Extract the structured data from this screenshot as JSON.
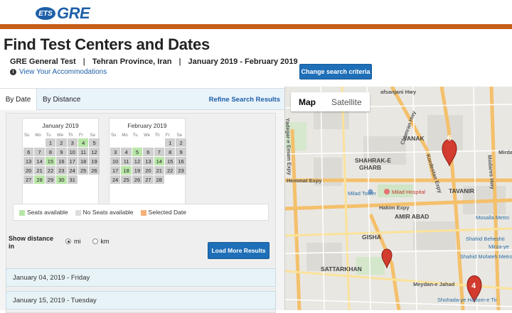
{
  "header": {
    "logo_ets": "ETS",
    "logo_gre": "GRE",
    "brand_color": "#1d5fa8",
    "accent_color": "#c65f1a"
  },
  "page": {
    "title": "Find Test Centers and Dates",
    "test": "GRE General Test",
    "location": "Tehran Province, Iran",
    "date_range": "January 2019 - February 2019",
    "accommodations_link": "View Your Accommodations",
    "change_button": "Change search criteria"
  },
  "tabs": {
    "by_date": "By Date",
    "by_distance": "By Distance",
    "refine": "Refine Search Results"
  },
  "calendars": [
    {
      "title": "January 2019",
      "dow": [
        "Su",
        "Mo",
        "Tu",
        "We",
        "Th",
        "Fr",
        "Sa"
      ],
      "lead_blanks": 2,
      "days": [
        {
          "d": "1",
          "s": "noseat"
        },
        {
          "d": "2",
          "s": "noseat"
        },
        {
          "d": "3",
          "s": "noseat"
        },
        {
          "d": "4",
          "s": "avail"
        },
        {
          "d": "5",
          "s": "noseat"
        },
        {
          "d": "6",
          "s": "noseat"
        },
        {
          "d": "7",
          "s": "noseat"
        },
        {
          "d": "8",
          "s": "noseat"
        },
        {
          "d": "9",
          "s": "noseat"
        },
        {
          "d": "10",
          "s": "noseat"
        },
        {
          "d": "11",
          "s": "noseat"
        },
        {
          "d": "12",
          "s": "noseat"
        },
        {
          "d": "13",
          "s": "noseat"
        },
        {
          "d": "14",
          "s": "noseat"
        },
        {
          "d": "15",
          "s": "avail"
        },
        {
          "d": "16",
          "s": "noseat"
        },
        {
          "d": "17",
          "s": "noseat"
        },
        {
          "d": "18",
          "s": "noseat"
        },
        {
          "d": "19",
          "s": "noseat"
        },
        {
          "d": "20",
          "s": "noseat"
        },
        {
          "d": "21",
          "s": "noseat"
        },
        {
          "d": "22",
          "s": "noseat"
        },
        {
          "d": "23",
          "s": "noseat"
        },
        {
          "d": "24",
          "s": "noseat"
        },
        {
          "d": "25",
          "s": "noseat"
        },
        {
          "d": "26",
          "s": "noseat"
        },
        {
          "d": "27",
          "s": "noseat"
        },
        {
          "d": "28",
          "s": "avail"
        },
        {
          "d": "29",
          "s": "noseat"
        },
        {
          "d": "30",
          "s": "avail"
        },
        {
          "d": "31",
          "s": "noseat"
        }
      ]
    },
    {
      "title": "February 2019",
      "dow": [
        "Su",
        "Mo",
        "Tu",
        "We",
        "Th",
        "Fr",
        "Sa"
      ],
      "lead_blanks": 5,
      "days": [
        {
          "d": "1",
          "s": "noseat"
        },
        {
          "d": "2",
          "s": "noseat"
        },
        {
          "d": "3",
          "s": "noseat"
        },
        {
          "d": "4",
          "s": "noseat"
        },
        {
          "d": "5",
          "s": "avail"
        },
        {
          "d": "6",
          "s": "noseat"
        },
        {
          "d": "7",
          "s": "noseat"
        },
        {
          "d": "8",
          "s": "noseat"
        },
        {
          "d": "9",
          "s": "noseat"
        },
        {
          "d": "10",
          "s": "noseat"
        },
        {
          "d": "11",
          "s": "noseat"
        },
        {
          "d": "12",
          "s": "noseat"
        },
        {
          "d": "13",
          "s": "noseat"
        },
        {
          "d": "14",
          "s": "avail"
        },
        {
          "d": "15",
          "s": "noseat"
        },
        {
          "d": "16",
          "s": "noseat"
        },
        {
          "d": "17",
          "s": "noseat"
        },
        {
          "d": "18",
          "s": "avail"
        },
        {
          "d": "19",
          "s": "noseat"
        },
        {
          "d": "20",
          "s": "noseat"
        },
        {
          "d": "21",
          "s": "noseat"
        },
        {
          "d": "22",
          "s": "noseat"
        },
        {
          "d": "23",
          "s": "noseat"
        },
        {
          "d": "24",
          "s": "noseat"
        },
        {
          "d": "25",
          "s": "noseat"
        },
        {
          "d": "26",
          "s": "noseat"
        },
        {
          "d": "27",
          "s": "noseat"
        },
        {
          "d": "28",
          "s": "noseat"
        }
      ]
    }
  ],
  "legend": {
    "available": "Seats available",
    "none": "No Seats available",
    "selected": "Selected Date"
  },
  "distance": {
    "label": "Show distance in",
    "mi": "mi",
    "km": "km",
    "selected": "mi"
  },
  "load_more": "Load More Results",
  "results": [
    "January 04, 2019 - Friday",
    "January 15, 2019 - Tuesday"
  ],
  "map": {
    "tab_map": "Map",
    "tab_satellite": "Satellite",
    "labels": {
      "vanak": "VANAK",
      "shahrak": "SHAHRAK-E",
      "gharb": "GHARB",
      "tavanir": "TAVANIR",
      "amir_abad": "AMIR ABAD",
      "gisha": "GISHA",
      "sattarkhan": "SATTARKHAN",
      "milad_tower": "Milad Tower",
      "milad_hospital": "Milad Hospital",
      "hemmat": "Hemmat Expy",
      "hakim": "Hakim Expy",
      "mosalla": "Mosalla Metro",
      "beheshti": "Shahid Beheshti",
      "mirza": "Mirza-ye",
      "mofateh": "Shahid Mofateh Metro",
      "meydan": "Meydan-e Jahad",
      "shohada": "Shohada-ye Haftom-e Tir",
      "afsarjani": "afsanjani Hwy",
      "modares": "Modares Hwy",
      "chamran": "Chamran Hwy",
      "kordestan": "Kordestan Expy",
      "yadegar": "Yadegar-e Emam Expy",
      "mirdam": "Mirdam"
    },
    "markers": [
      "6",
      "4"
    ]
  }
}
